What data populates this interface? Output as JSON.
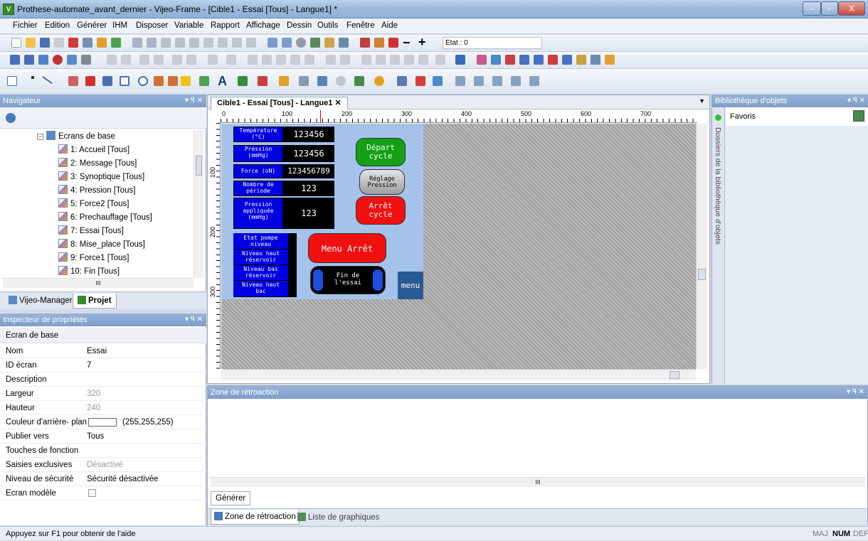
{
  "window": {
    "title": "Prothese-automate_avant_dernier - Vijeo-Frame - [Cible1 - Essai [Tous] - Langue1] *",
    "min": "–",
    "max": "▫",
    "close": "X"
  },
  "menu": [
    "Fichier",
    "Edition",
    "Générer",
    "IHM",
    "Disposer",
    "Variable",
    "Rapport",
    "Affichage",
    "Dessin",
    "Outils",
    "Fenêtre",
    "Aide"
  ],
  "toolbar": {
    "etat_label": "Etat : 0"
  },
  "navigator": {
    "title": "Navigateur",
    "group": "Ecrans de base",
    "items": [
      "1: Accueil [Tous]",
      "2: Message [Tous]",
      "3: Synoptique [Tous]",
      "4: Pression [Tous]",
      "5: Force2 [Tous]",
      "6: Prechauffage [Tous]",
      "7: Essai [Tous]",
      "8: Mise_place [Tous]",
      "9: Force1 [Tous]",
      "10: Fin [Tous]"
    ],
    "tabs": [
      "Vijeo-Manager",
      "Projet"
    ],
    "scroll_mark": "III"
  },
  "inspector": {
    "title": "Inspecteur de propriétés",
    "section": "Ecran de base",
    "rows": [
      {
        "k": "Nom",
        "v": "Essai"
      },
      {
        "k": "ID écran",
        "v": "7"
      },
      {
        "k": "Description",
        "v": ""
      },
      {
        "k": "Largeur",
        "v": "320"
      },
      {
        "k": "Hauteur",
        "v": "240"
      },
      {
        "k": "Couleur d'arrière- plan",
        "v": "(255,255,255)"
      },
      {
        "k": "Publier vers",
        "v": "Tous"
      },
      {
        "k": "Touches de fonction",
        "v": ""
      },
      {
        "k": "Saisies exclusives",
        "v": "Désactivé"
      },
      {
        "k": "Niveau de sécurité",
        "v": "Sécurité désactivée"
      },
      {
        "k": "Ecran modèle",
        "v": ""
      }
    ]
  },
  "editor": {
    "tab": "Cible1 - Essai [Tous] - Langue1",
    "ruler_h": [
      "0",
      "100",
      "200",
      "300",
      "400",
      "500",
      "600",
      "700"
    ],
    "ruler_v": [
      "100",
      "200",
      "300"
    ]
  },
  "hmi": {
    "rows": [
      {
        "label": "Température\n(°C)",
        "value": "123456"
      },
      {
        "label": "Pression\n(mmHg)",
        "value": "123456"
      },
      {
        "label": "Force (oN)",
        "value": "123456789"
      },
      {
        "label": "Nombre de\npériode",
        "value": "123"
      },
      {
        "label": "Pression\nappliquée\n(mmHg)",
        "value": "123"
      }
    ],
    "status": [
      "Etat pompe\nniveau",
      "Niveau haut\nréservoir",
      "Niveau bas\nréservoir",
      "Niveau haut\nbac"
    ],
    "depart": "Départ\ncycle",
    "reglage": "Réglage\nPression",
    "arret": "Arrêt\ncycle",
    "menu_arret": "Menu Arrêt",
    "fin": "Fin de\nl'essai",
    "menu": "menu"
  },
  "library": {
    "title": "Bibliothèque d'objets",
    "favoris": "Favoris",
    "side": "Dossiers de la bibliothèque d'objets"
  },
  "feedback": {
    "title": "Zone de rétroaction",
    "button": "Générer",
    "tabs": [
      "Zone de rétroaction",
      "Liste de graphiques"
    ],
    "scroll_mark": "III"
  },
  "status": {
    "help": "Appuyez sur F1 pour obtenir de l'aide",
    "maj": "MAJ",
    "num": "NUM",
    "def": "DEF"
  }
}
